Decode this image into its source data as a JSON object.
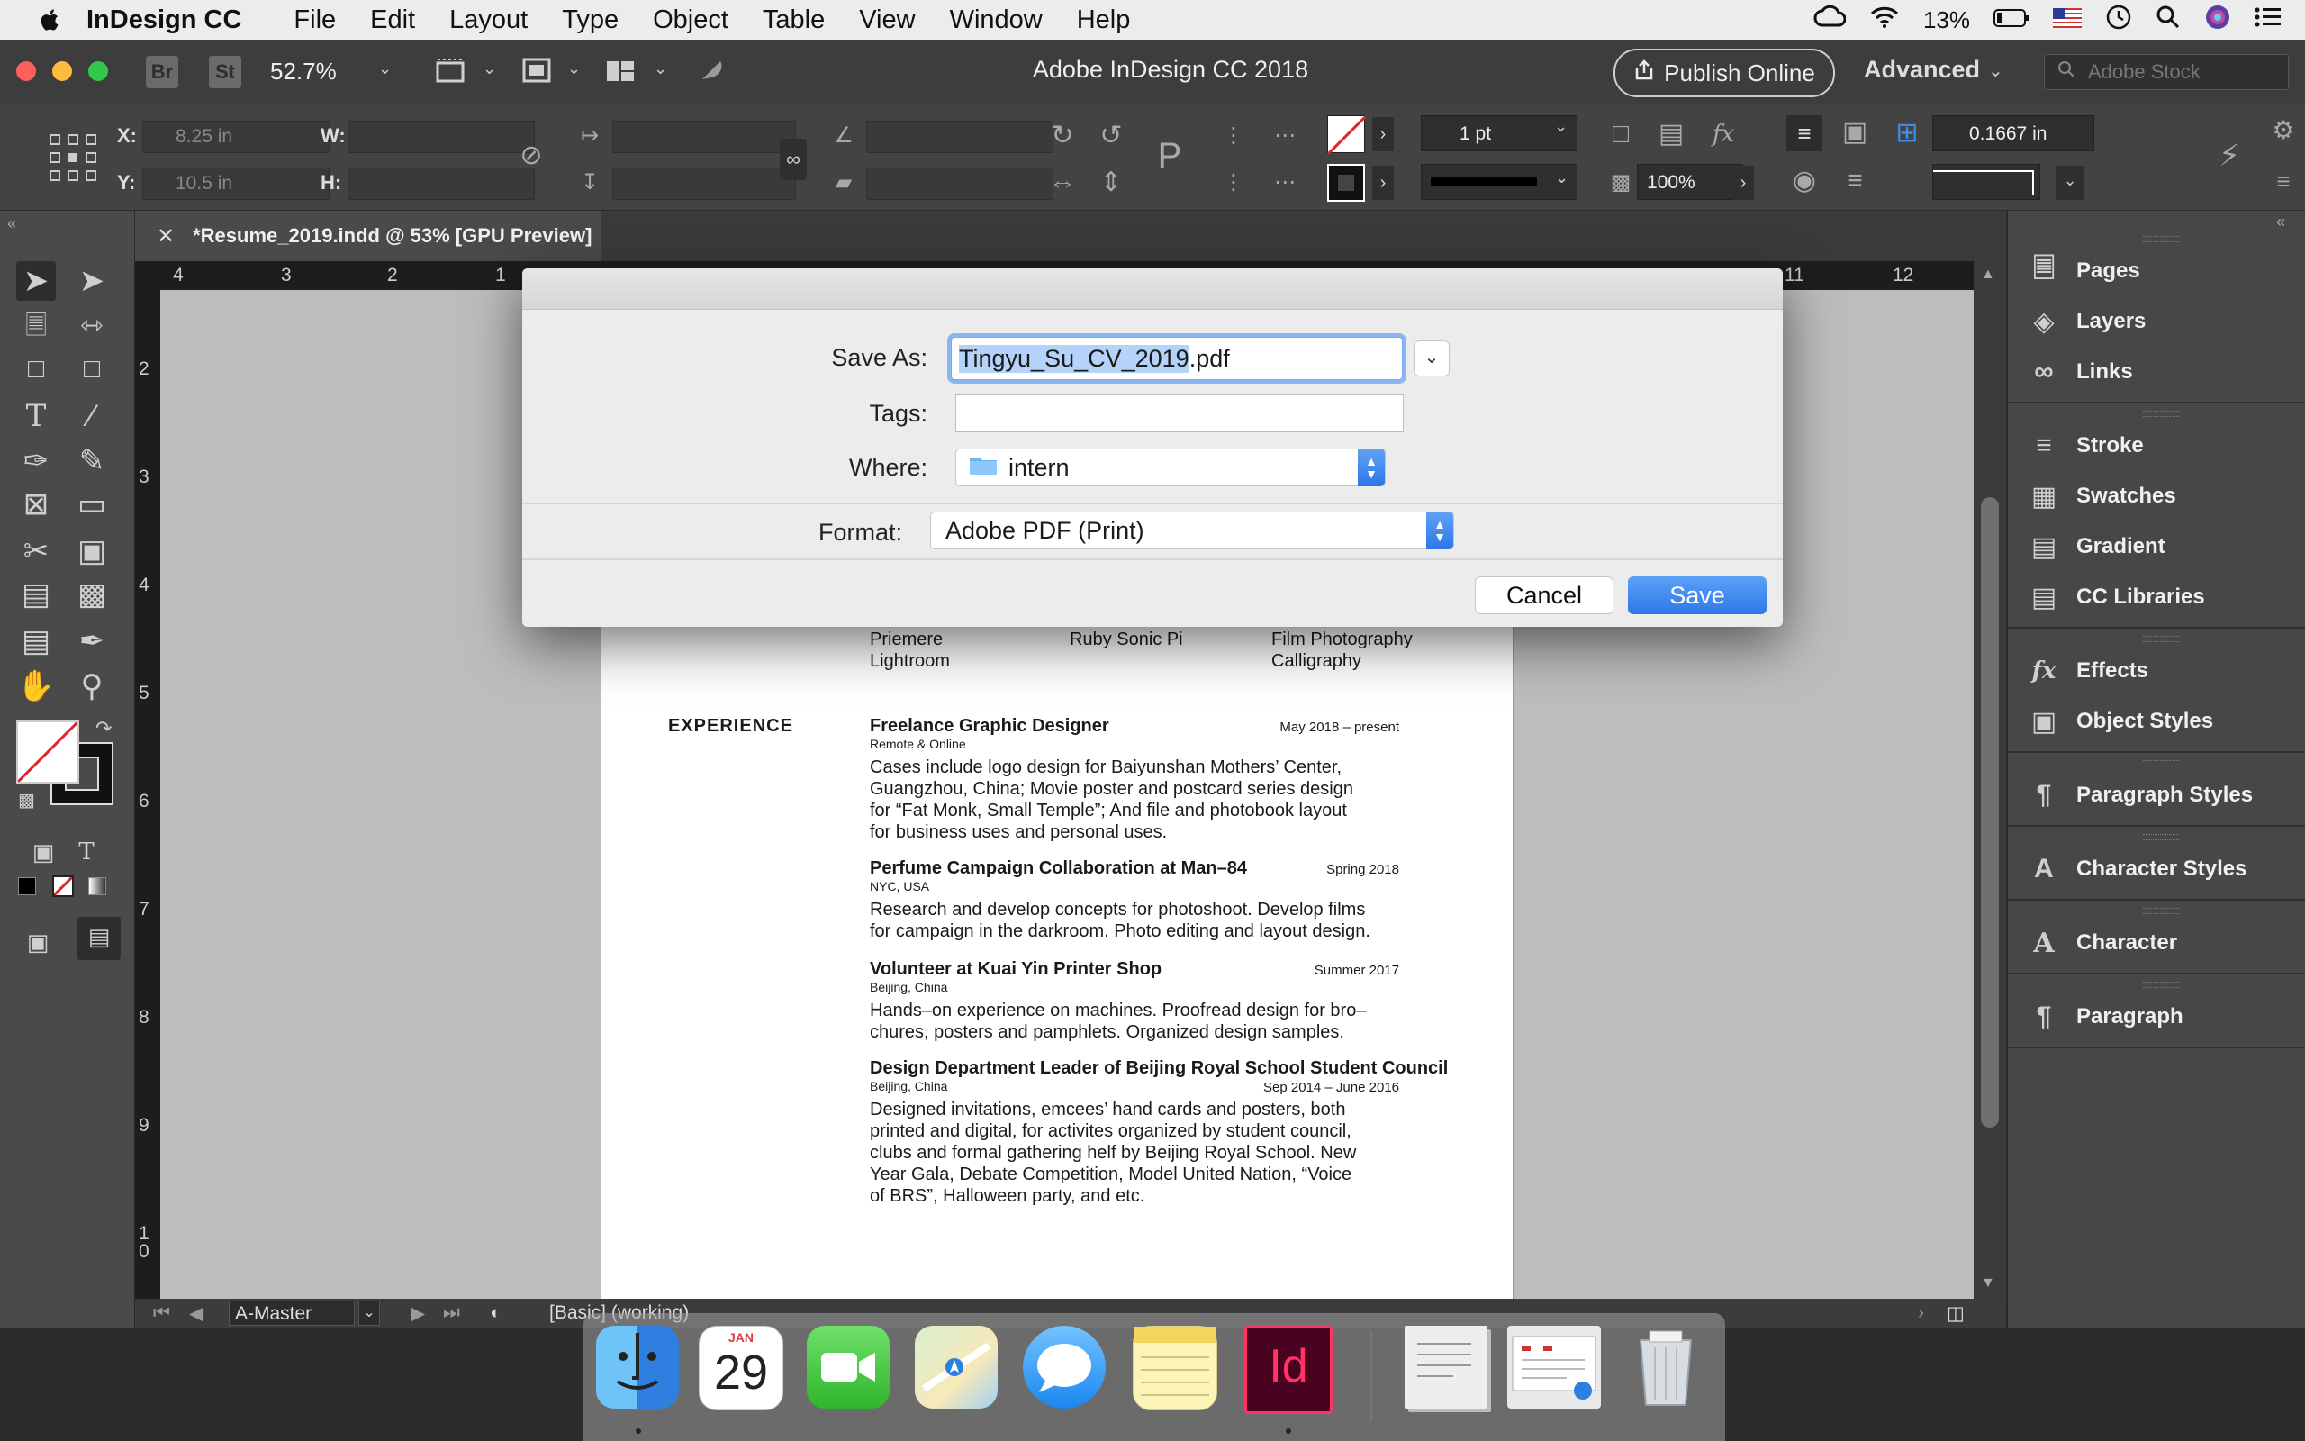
{
  "menubar": {
    "app_name": "InDesign CC",
    "items": [
      "File",
      "Edit",
      "Layout",
      "Type",
      "Object",
      "Table",
      "View",
      "Window",
      "Help"
    ],
    "battery": "13%"
  },
  "appbar": {
    "bridge": "Br",
    "stock_app": "St",
    "zoom": "52.7%",
    "title": "Adobe InDesign CC 2018",
    "publish": "Publish Online",
    "workspace": "Advanced",
    "search_placeholder": "Adobe Stock"
  },
  "control": {
    "x_label": "X:",
    "x_value": "8.25 in",
    "y_label": "Y:",
    "y_value": "10.5 in",
    "w_label": "W:",
    "h_label": "H:",
    "stroke_weight": "1 pt",
    "opacity": "100%",
    "offset": "0.1667 in"
  },
  "document": {
    "tab_title": "*Resume_2019.indd @ 53% [GPU Preview]",
    "ruler_h": [
      "4",
      "3",
      "2",
      "1",
      "11",
      "12"
    ],
    "ruler_v": [
      "2",
      "3",
      "4",
      "5",
      "6",
      "7",
      "8",
      "9",
      "1",
      "0"
    ]
  },
  "status": {
    "master": "A-Master",
    "style": "[Basic] (working)"
  },
  "panels": [
    "Pages",
    "Layers",
    "Links",
    "Stroke",
    "Swatches",
    "Gradient",
    "CC Libraries",
    "Effects",
    "Object Styles",
    "Paragraph Styles",
    "Character Styles",
    "Character",
    "Paragraph"
  ],
  "dialog": {
    "save_as_label": "Save As:",
    "save_as_value_selected": "Tingyu_Su_CV_2019",
    "save_as_value_ext": ".pdf",
    "tags_label": "Tags:",
    "where_label": "Where:",
    "where_value": "intern",
    "format_label": "Format:",
    "format_value": "Adobe PDF (Print)",
    "cancel": "Cancel",
    "save": "Save"
  },
  "resume": {
    "skills_col1": [
      "Priemere",
      "Lightroom"
    ],
    "skills_col2": [
      "Ruby Sonic Pi"
    ],
    "skills_col3": [
      "Film Photography",
      "Calligraphy"
    ],
    "section": "EXPERIENCE",
    "jobs": [
      {
        "title": "Freelance Graphic Designer",
        "loc": "Remote & Online",
        "date": "May 2018 – present",
        "lines": [
          "Cases include logo design for Baiyunshan Mothers’ Center,",
          "Guangzhou, China; Movie poster and postcard series design",
          "for “Fat Monk, Small Temple”; And file and photobook layout",
          "for business uses and personal uses."
        ]
      },
      {
        "title": "Perfume Campaign Collaboration at Man–84",
        "loc": "NYC, USA",
        "date": "Spring 2018",
        "lines": [
          "Research and develop concepts for photoshoot. Develop films",
          "for campaign in the darkroom. Photo editing and layout design."
        ]
      },
      {
        "title": "Volunteer at Kuai Yin Printer Shop",
        "loc": "Beijing, China",
        "date": "Summer 2017",
        "lines": [
          "Hands–on experience on machines. Proofread design for bro–",
          "chures, posters and pamphlets. Organized design samples."
        ]
      },
      {
        "title": "Design Department Leader of Beijing Royal School Student Council",
        "loc": "Beijing, China",
        "date": "Sep 2014 – June 2016",
        "lines": [
          "Designed invitations, emcees’ hand cards and posters, both",
          "printed and digital, for activites organized by student council,",
          "clubs and formal gathering helf by Beijing Royal School. New",
          "Year Gala, Debate Competition, Model United Nation, “Voice",
          "of BRS”, Halloween party, and etc."
        ]
      }
    ]
  },
  "dock": {
    "calendar_month": "JAN",
    "calendar_day": "29",
    "indesign_label": "Id"
  }
}
